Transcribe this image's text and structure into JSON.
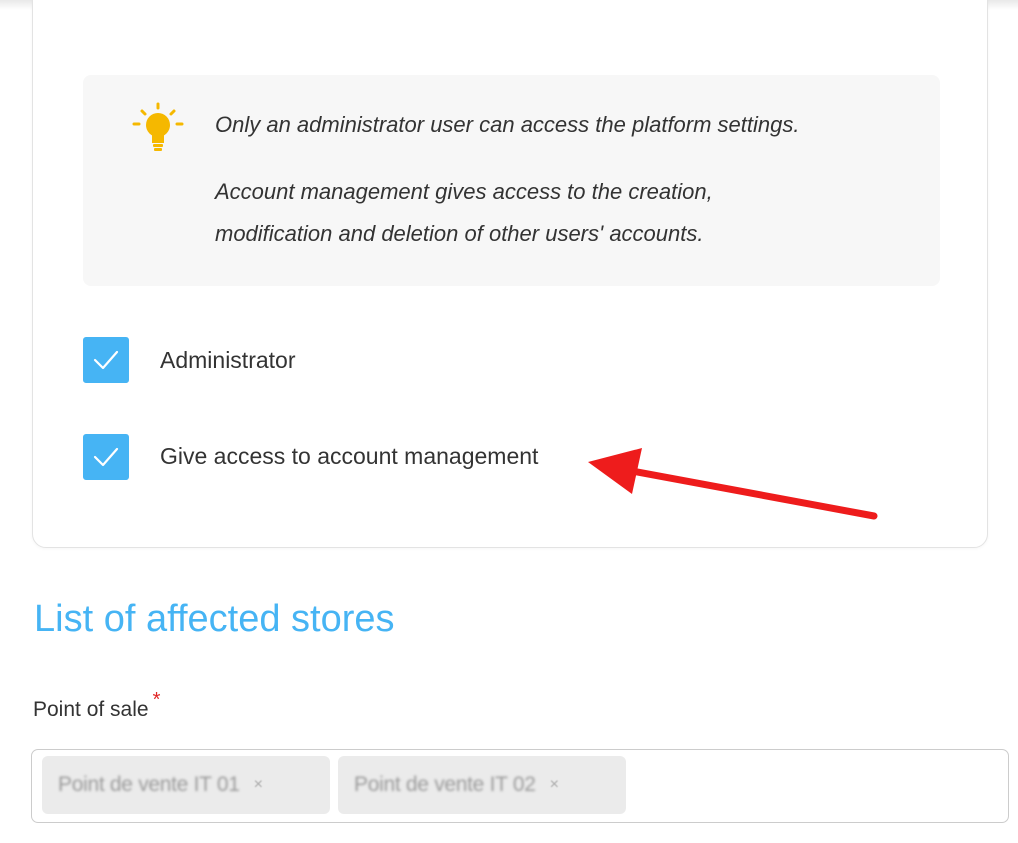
{
  "info": {
    "line1": "Only an administrator user can access the platform settings.",
    "line2": "Account management gives access to the creation,",
    "line3": "modification and deletion of other users' accounts.",
    "icon": "lightbulb-icon"
  },
  "checkboxes": [
    {
      "label": "Administrator",
      "checked": true
    },
    {
      "label": "Give access to account management",
      "checked": true
    }
  ],
  "section": {
    "title": "List of affected stores"
  },
  "point_of_sale": {
    "label": "Point of sale",
    "required_mark": "*",
    "selected": [
      {
        "label": "Point de vente IT 01",
        "remove": "×"
      },
      {
        "label": "Point de vente IT 02",
        "remove": "×"
      }
    ]
  },
  "colors": {
    "accent": "#46b4f4",
    "annotation_arrow": "#ee1c1c",
    "required": "#e02424",
    "bulb": "#f5b800"
  }
}
